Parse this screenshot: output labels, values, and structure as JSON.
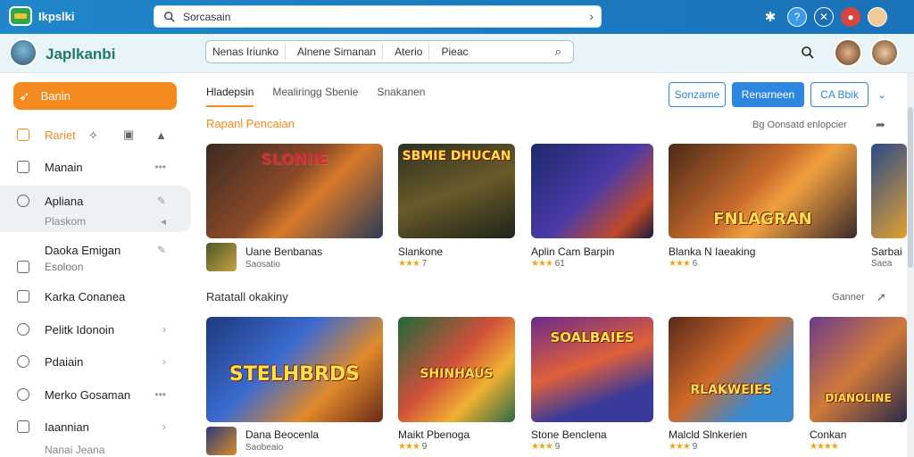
{
  "app": {
    "title": "Ikpslki"
  },
  "search": {
    "value": "Sorcasain"
  },
  "subbar": {
    "brand": "Japlkanbi",
    "filters": [
      "Nenas Iriunko",
      "Alnene Simanan",
      "Aterio",
      "Pieac"
    ]
  },
  "sidebar": {
    "primary": "Banin",
    "items": [
      {
        "label": "Rariet"
      },
      {
        "label": "Manain"
      },
      {
        "label": "Apliana"
      },
      {
        "label": "Plaskom"
      },
      {
        "label": "Daoka Emigan"
      },
      {
        "label": "Esoloon"
      },
      {
        "label": "Karka Conanea"
      },
      {
        "label": "Pelitk Idonoin"
      },
      {
        "label": "Pdaiain"
      },
      {
        "label": "Merko Gosaman"
      },
      {
        "label": "Iaannian"
      },
      {
        "label": "Nanai Jeana"
      }
    ]
  },
  "tabs": [
    "Hladepsin",
    "Mealiringg Sbenie",
    "Snakanen"
  ],
  "buttons": {
    "b1": "Sonzame",
    "b2": "Renarneen",
    "b3": "CA Bbik"
  },
  "section1": {
    "title": "Rapanl Pencaian",
    "right": "Bg Oonsatd enlopcier",
    "cards": [
      {
        "art": "SLONIIE",
        "title": "Uane Benbanas",
        "meta": "Saosatio"
      },
      {
        "art": "SBMIE DHUCAN",
        "title": "Slankone",
        "meta": "7"
      },
      {
        "art": "",
        "title": "Aplin Cam Barpin",
        "meta": "61"
      },
      {
        "art": "FNLAGRAN",
        "title": "Blanka N Iaeaking",
        "meta": "6"
      },
      {
        "art": "",
        "title": "Sarbai",
        "meta": "Saea"
      }
    ]
  },
  "section2": {
    "title": "Ratatall okakiny",
    "right": "Ganner",
    "cards": [
      {
        "art": "STELHBRDS",
        "title": "Dana Beocenla",
        "meta": "Saobeaio"
      },
      {
        "art": "SHINHAUS",
        "title": "Maikt Pbenoga",
        "meta": "9"
      },
      {
        "art": "SOALBAIES",
        "title": "Stone Benclena",
        "meta": "9"
      },
      {
        "art": "RLAKWEIES",
        "title": "Malcld Slnkerien",
        "meta": "9"
      },
      {
        "art": "DIANOLINE",
        "title": "Conkan",
        "meta": ""
      }
    ]
  }
}
